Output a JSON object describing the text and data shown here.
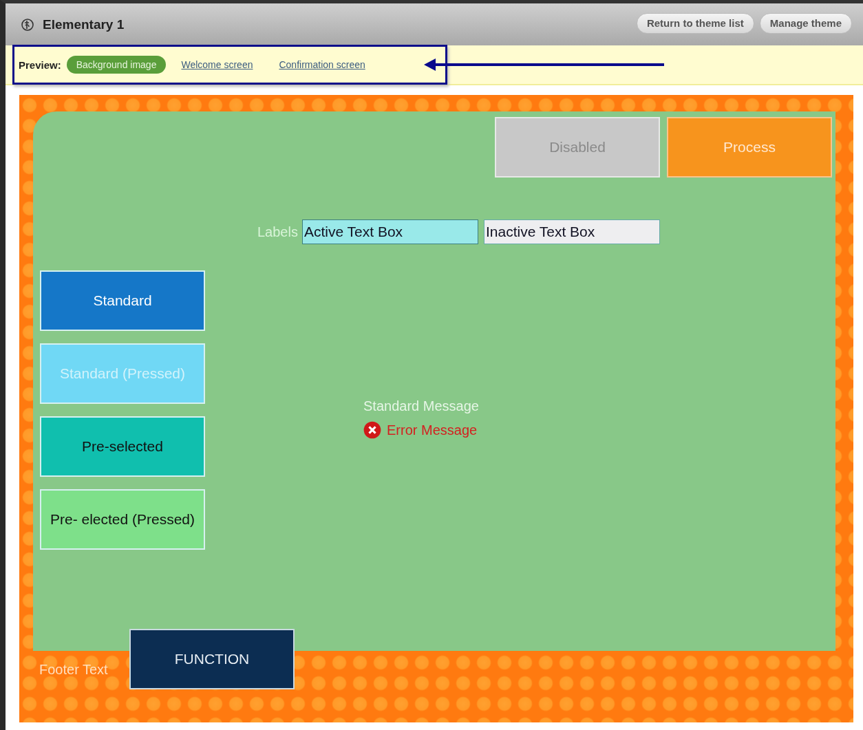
{
  "window": {
    "title": "Elementary 1"
  },
  "header_buttons": [
    "Return to theme list",
    "Manage theme"
  ],
  "preview": {
    "label": "Preview:",
    "tabs": [
      {
        "label": "Background image",
        "selected": true
      },
      {
        "label": "Welcome screen",
        "selected": false
      },
      {
        "label": "Confirmation screen",
        "selected": false
      }
    ]
  },
  "theme_preview": {
    "top_buttons": [
      {
        "label": "Disabled",
        "kind": "disabled"
      },
      {
        "label": "Process",
        "kind": "process"
      }
    ],
    "field_label": "Labels",
    "fields": [
      {
        "value": "Active Text Box",
        "active": true
      },
      {
        "value": "Inactive Text Box",
        "active": false
      }
    ],
    "side_buttons": [
      {
        "label": "Standard",
        "kind": "standard"
      },
      {
        "label": "Standard (Pressed)",
        "kind": "standard-pressed"
      },
      {
        "label": "Pre-selected",
        "kind": "preselected"
      },
      {
        "label": "Pre- elected (Pressed)",
        "kind": "preselected-pressed"
      }
    ],
    "messages": [
      {
        "text": "Standard Message",
        "kind": "standard"
      },
      {
        "text": "Error Message",
        "kind": "error"
      }
    ],
    "footer_text": "Footer Text",
    "function_button": "FUNCTION"
  }
}
